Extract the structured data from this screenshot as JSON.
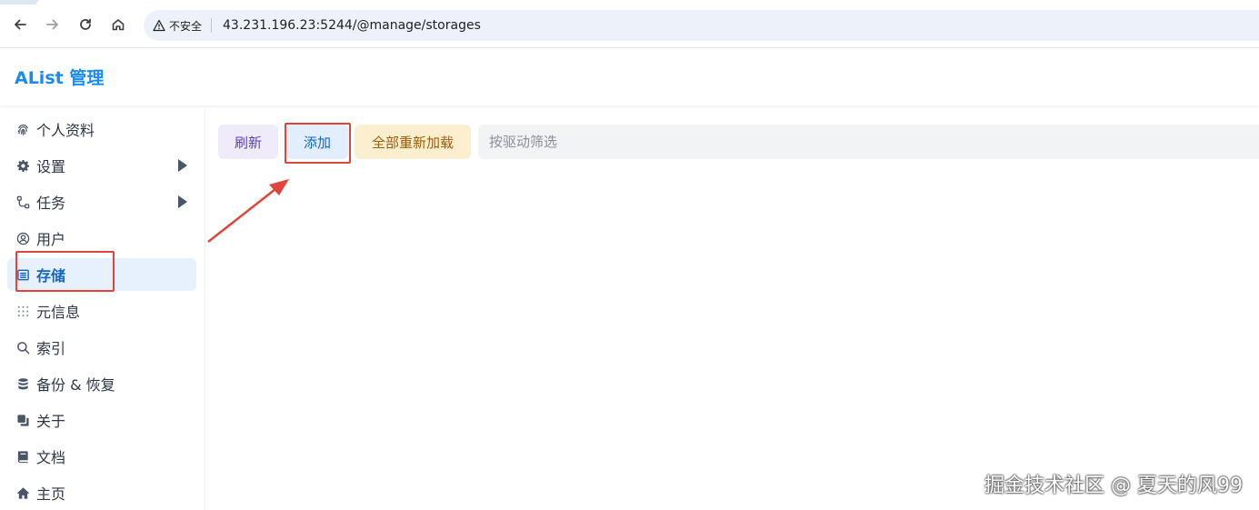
{
  "browser": {
    "security_label": "不安全",
    "url": "43.231.196.23:5244/@manage/storages"
  },
  "app": {
    "title": "AList 管理"
  },
  "sidebar": {
    "items": [
      {
        "label": "个人资料",
        "icon": "fingerprint-icon"
      },
      {
        "label": "设置",
        "icon": "gear-icon",
        "expandable": true
      },
      {
        "label": "任务",
        "icon": "flow-icon",
        "expandable": true
      },
      {
        "label": "用户",
        "icon": "user-circle-icon"
      },
      {
        "label": "存储",
        "icon": "storage-icon",
        "active": true
      },
      {
        "label": "元信息",
        "icon": "metadata-icon"
      },
      {
        "label": "索引",
        "icon": "search-icon"
      },
      {
        "label": "备份 & 恢复",
        "icon": "database-icon"
      },
      {
        "label": "关于",
        "icon": "copy-icon"
      },
      {
        "label": "文档",
        "icon": "book-icon"
      },
      {
        "label": "主页",
        "icon": "home-icon"
      }
    ]
  },
  "toolbar": {
    "refresh_label": "刷新",
    "add_label": "添加",
    "reload_all_label": "全部重新加载",
    "filter_placeholder": "按驱动筛选"
  },
  "watermark": "掘金技术社区 @ 夏天的风99",
  "colors": {
    "accent": "#1a8cf0",
    "active_bg": "#e6f1fd",
    "annotation": "#e0443c"
  }
}
